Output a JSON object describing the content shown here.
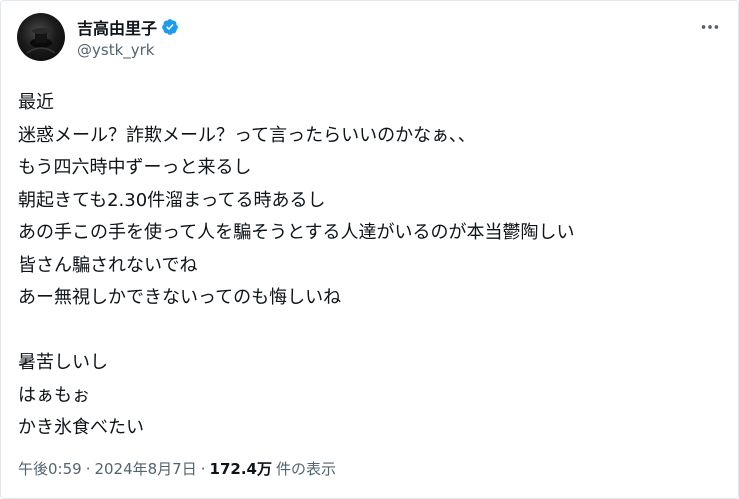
{
  "author": {
    "display_name": "吉高由里子",
    "handle": "@ystk_yrk",
    "verified_icon": "verified-badge-icon",
    "accent_color": "#1d9bf0"
  },
  "menu": {
    "icon": "more-horizontal-icon"
  },
  "tweet": {
    "lines": [
      "最近",
      "迷惑メール？詐欺メール？って言ったらいいのかなぁ、、",
      "もう四六時中ずーっと来るし",
      "朝起きても2.30件溜まってる時あるし",
      "あの手この手を使って人を騙そうとする人達がいるのが本当鬱陶しい",
      "皆さん騙されないでね",
      "あー無視しかできないってのも悔しいね",
      "",
      "暑苦しいし",
      "はぁもぉ",
      "かき氷食べたい"
    ]
  },
  "meta": {
    "time": "午後0:59",
    "separator": "·",
    "date": "2024年8月7日",
    "views_count": "172.4万",
    "views_label": "件の表示"
  },
  "colors": {
    "text": "#0f1419",
    "secondary": "#536471",
    "border": "#e1e8ed"
  }
}
